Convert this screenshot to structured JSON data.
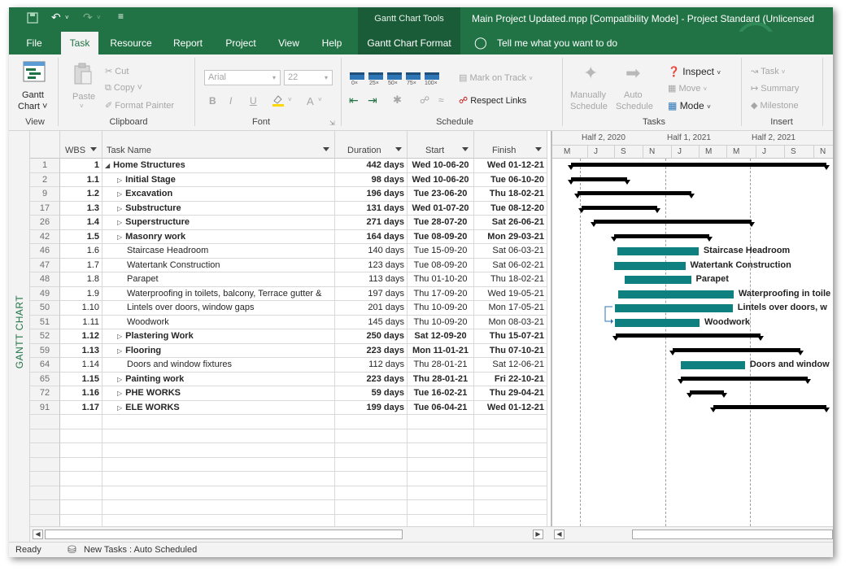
{
  "titlebar": {
    "contextual_title": "Gantt Chart Tools",
    "app_title": "Main Project Updated.mpp [Compatibility Mode]  -  Project Standard (Unlicensed"
  },
  "tabs": [
    "File",
    "Task",
    "Resource",
    "Report",
    "Project",
    "View",
    "Help",
    "Gantt Chart Format"
  ],
  "tell_me": "Tell me what you want to do",
  "ribbon": {
    "view": {
      "label": "View",
      "gantt_btn": "Gantt",
      "gantt_btn2": "Chart ˅"
    },
    "clipboard": {
      "label": "Clipboard",
      "paste": "Paste",
      "paste_arrow": "˅",
      "cut": "Cut",
      "copy": "Copy  ˅",
      "format_painter": "Format Painter"
    },
    "font": {
      "label": "Font",
      "font_name": "Arial",
      "font_size": "22",
      "bold": "B",
      "italic": "I",
      "underline": "U",
      "fontcolor": "A"
    },
    "schedule": {
      "label": "Schedule",
      "scale": [
        "0×",
        "25×",
        "50×",
        "75×",
        "100×"
      ],
      "mark_on_track": "Mark on Track",
      "respect_links": "Respect Links"
    },
    "tasks": {
      "label": "Tasks",
      "manual": [
        "Manually",
        "Schedule"
      ],
      "auto": [
        "Auto",
        "Schedule"
      ],
      "inspect": "Inspect",
      "move": "Move",
      "mode": "Mode"
    },
    "insert": {
      "label": "Insert",
      "task": "Task",
      "summary": "Summary",
      "milestone": "Milestone"
    }
  },
  "sidebar_label": "GANTT CHART",
  "columns": {
    "wbs": "WBS",
    "name": "Task Name",
    "duration": "Duration",
    "start": "Start",
    "finish": "Finish"
  },
  "rows": [
    {
      "id": "1",
      "wbs": "1",
      "name": "Home Structures",
      "duration": "442 days",
      "start": "Wed 10-06-20",
      "finish": "Wed 01-12-21",
      "summary": true,
      "level": 0,
      "expander": "◢"
    },
    {
      "id": "2",
      "wbs": "1.1",
      "name": "Initial Stage",
      "duration": "98 days",
      "start": "Wed 10-06-20",
      "finish": "Tue 06-10-20",
      "summary": true,
      "level": 1,
      "expander": "▷"
    },
    {
      "id": "9",
      "wbs": "1.2",
      "name": "Excavation",
      "duration": "196 days",
      "start": "Tue 23-06-20",
      "finish": "Thu 18-02-21",
      "summary": true,
      "level": 1,
      "expander": "▷"
    },
    {
      "id": "17",
      "wbs": "1.3",
      "name": "Substructure",
      "duration": "131 days",
      "start": "Wed 01-07-20",
      "finish": "Tue 08-12-20",
      "summary": true,
      "level": 1,
      "expander": "▷"
    },
    {
      "id": "26",
      "wbs": "1.4",
      "name": "Superstructure",
      "duration": "271 days",
      "start": "Tue 28-07-20",
      "finish": "Sat 26-06-21",
      "summary": true,
      "level": 1,
      "expander": "▷"
    },
    {
      "id": "42",
      "wbs": "1.5",
      "name": "Masonry work",
      "duration": "164 days",
      "start": "Tue 08-09-20",
      "finish": "Mon 29-03-21",
      "summary": true,
      "level": 1,
      "expander": "▷"
    },
    {
      "id": "46",
      "wbs": "1.6",
      "name": "Staircase Headroom",
      "duration": "140 days",
      "start": "Tue 15-09-20",
      "finish": "Sat 06-03-21",
      "summary": false,
      "level": 2,
      "expander": ""
    },
    {
      "id": "47",
      "wbs": "1.7",
      "name": "Watertank Construction",
      "duration": "123 days",
      "start": "Tue 08-09-20",
      "finish": "Sat 06-02-21",
      "summary": false,
      "level": 2,
      "expander": ""
    },
    {
      "id": "48",
      "wbs": "1.8",
      "name": "Parapet",
      "duration": "113 days",
      "start": "Thu 01-10-20",
      "finish": "Thu 18-02-21",
      "summary": false,
      "level": 2,
      "expander": ""
    },
    {
      "id": "49",
      "wbs": "1.9",
      "name": "Waterproofing in toilets, balcony, Terrace gutter &",
      "duration": "197 days",
      "start": "Thu 17-09-20",
      "finish": "Wed 19-05-21",
      "summary": false,
      "level": 2,
      "expander": ""
    },
    {
      "id": "50",
      "wbs": "1.10",
      "name": "Lintels over doors, window gaps",
      "duration": "201 days",
      "start": "Thu 10-09-20",
      "finish": "Mon 17-05-21",
      "summary": false,
      "level": 2,
      "expander": ""
    },
    {
      "id": "51",
      "wbs": "1.11",
      "name": "Woodwork",
      "duration": "145 days",
      "start": "Thu 10-09-20",
      "finish": "Mon 08-03-21",
      "summary": false,
      "level": 2,
      "expander": ""
    },
    {
      "id": "52",
      "wbs": "1.12",
      "name": "Plastering Work",
      "duration": "250 days",
      "start": "Sat 12-09-20",
      "finish": "Thu 15-07-21",
      "summary": true,
      "level": 1,
      "expander": "▷"
    },
    {
      "id": "59",
      "wbs": "1.13",
      "name": "Flooring",
      "duration": "223 days",
      "start": "Mon 11-01-21",
      "finish": "Thu 07-10-21",
      "summary": true,
      "level": 1,
      "expander": "▷"
    },
    {
      "id": "64",
      "wbs": "1.14",
      "name": "Doors and window fixtures",
      "duration": "112 days",
      "start": "Thu 28-01-21",
      "finish": "Sat 12-06-21",
      "summary": false,
      "level": 2,
      "expander": ""
    },
    {
      "id": "65",
      "wbs": "1.15",
      "name": "Painting work",
      "duration": "223 days",
      "start": "Thu 28-01-21",
      "finish": "Fri 22-10-21",
      "summary": true,
      "level": 1,
      "expander": "▷"
    },
    {
      "id": "72",
      "wbs": "1.16",
      "name": "PHE WORKS",
      "duration": "59 days",
      "start": "Tue 16-02-21",
      "finish": "Thu 29-04-21",
      "summary": true,
      "level": 1,
      "expander": "▷"
    },
    {
      "id": "91",
      "wbs": "1.17",
      "name": "ELE WORKS",
      "duration": "199 days",
      "start": "Tue 06-04-21",
      "finish": "Wed 01-12-21",
      "summary": true,
      "level": 1,
      "expander": "▷"
    }
  ],
  "timescale": {
    "top": [
      "Half 2, 2020",
      "Half 1, 2021",
      "Half 2, 2021"
    ],
    "bottom": [
      "M",
      "J",
      "S",
      "N",
      "J",
      "M",
      "M",
      "J",
      "S",
      "N"
    ]
  },
  "bar_labels": [
    "Staircase Headroom",
    "Watertank Construction",
    "Parapet",
    "Waterproofing in toile",
    "Lintels over doors, w",
    "Woodwork",
    "Doors and window"
  ],
  "status": {
    "ready": "Ready",
    "new_tasks": "New Tasks : Auto Scheduled"
  },
  "colors": {
    "brand": "#217346",
    "task_bar": "#0e8080",
    "summary_bar": "#000000"
  }
}
